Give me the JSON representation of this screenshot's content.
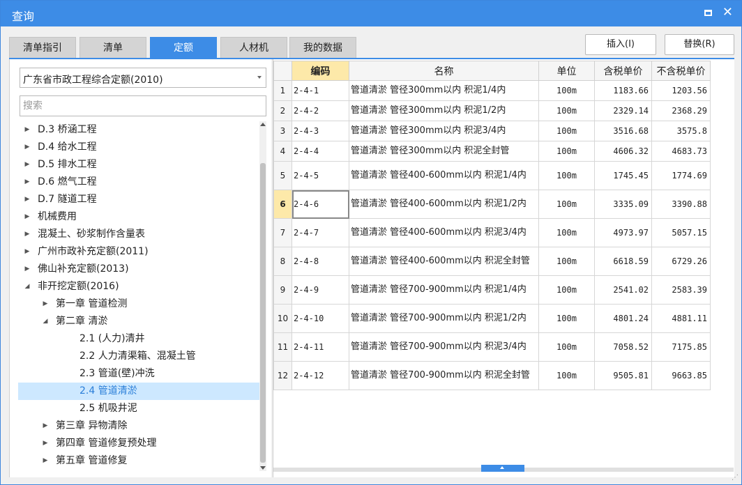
{
  "window": {
    "title": "查询",
    "max_icon": "maximize-icon",
    "close_glyph": "✕"
  },
  "tabs": [
    {
      "label": "清单指引",
      "active": false
    },
    {
      "label": "清单",
      "active": false
    },
    {
      "label": "定额",
      "active": true
    },
    {
      "label": "人材机",
      "active": false
    },
    {
      "label": "我的数据",
      "active": false
    }
  ],
  "toolbar": {
    "insert_label": "插入(I)",
    "replace_label": "替换(R)"
  },
  "left": {
    "selected_library": "广东省市政工程综合定额(2010)",
    "search_placeholder": "搜索",
    "tree": [
      {
        "label": "D.3 桥涵工程",
        "level": 0,
        "toggle": "collapsed"
      },
      {
        "label": "D.4 给水工程",
        "level": 0,
        "toggle": "collapsed"
      },
      {
        "label": "D.5 排水工程",
        "level": 0,
        "toggle": "collapsed"
      },
      {
        "label": "D.6 燃气工程",
        "level": 0,
        "toggle": "collapsed"
      },
      {
        "label": "D.7 隧道工程",
        "level": 0,
        "toggle": "collapsed"
      },
      {
        "label": "机械费用",
        "level": 0,
        "toggle": "collapsed"
      },
      {
        "label": "混凝土、砂浆制作含量表",
        "level": 0,
        "toggle": "collapsed"
      },
      {
        "label": "广州市政补充定额(2011)",
        "level": 0,
        "toggle": "collapsed"
      },
      {
        "label": "佛山补充定额(2013)",
        "level": 0,
        "toggle": "collapsed"
      },
      {
        "label": "非开挖定额(2016)",
        "level": 0,
        "toggle": "expanded"
      },
      {
        "label": "第一章 管道检测",
        "level": 1,
        "toggle": "collapsed"
      },
      {
        "label": "第二章 清淤",
        "level": 1,
        "toggle": "expanded"
      },
      {
        "label": "2.1 (人力)清井",
        "level": 2,
        "toggle": "none"
      },
      {
        "label": "2.2 人力清渠箱、混凝土管",
        "level": 2,
        "toggle": "none"
      },
      {
        "label": "2.3 管道(壁)冲洗",
        "level": 2,
        "toggle": "none"
      },
      {
        "label": "2.4 管道清淤",
        "level": 2,
        "toggle": "none",
        "selected": true
      },
      {
        "label": "2.5 机吸井泥",
        "level": 2,
        "toggle": "none"
      },
      {
        "label": "第三章 异物清除",
        "level": 1,
        "toggle": "collapsed"
      },
      {
        "label": "第四章 管道修复预处理",
        "level": 1,
        "toggle": "collapsed"
      },
      {
        "label": "第五章 管道修复",
        "level": 1,
        "toggle": "collapsed"
      }
    ]
  },
  "grid": {
    "columns": [
      "编码",
      "名称",
      "单位",
      "含税单价",
      "不含税单价"
    ],
    "current_row": 6,
    "rows": [
      {
        "idx": "1",
        "code": "2-4-1",
        "name": "管道清淤 管径300mm以内 积泥1/4内",
        "unit": "100m",
        "tax": "1183.66",
        "notax": "1203.56"
      },
      {
        "idx": "2",
        "code": "2-4-2",
        "name": "管道清淤 管径300mm以内 积泥1/2内",
        "unit": "100m",
        "tax": "2329.14",
        "notax": "2368.29"
      },
      {
        "idx": "3",
        "code": "2-4-3",
        "name": "管道清淤 管径300mm以内 积泥3/4内",
        "unit": "100m",
        "tax": "3516.68",
        "notax": "3575.8"
      },
      {
        "idx": "4",
        "code": "2-4-4",
        "name": "管道清淤 管径300mm以内 积泥全封管",
        "unit": "100m",
        "tax": "4606.32",
        "notax": "4683.73"
      },
      {
        "idx": "5",
        "code": "2-4-5",
        "name": "管道清淤 管径400-600mm以内 积泥1/4内",
        "unit": "100m",
        "tax": "1745.45",
        "notax": "1774.69"
      },
      {
        "idx": "6",
        "code": "2-4-6",
        "name": "管道清淤 管径400-600mm以内 积泥1/2内",
        "unit": "100m",
        "tax": "3335.09",
        "notax": "3390.88"
      },
      {
        "idx": "7",
        "code": "2-4-7",
        "name": "管道清淤 管径400-600mm以内 积泥3/4内",
        "unit": "100m",
        "tax": "4973.97",
        "notax": "5057.15"
      },
      {
        "idx": "8",
        "code": "2-4-8",
        "name": "管道清淤 管径400-600mm以内 积泥全封管",
        "unit": "100m",
        "tax": "6618.59",
        "notax": "6729.26"
      },
      {
        "idx": "9",
        "code": "2-4-9",
        "name": "管道清淤 管径700-900mm以内 积泥1/4内",
        "unit": "100m",
        "tax": "2541.02",
        "notax": "2583.39"
      },
      {
        "idx": "10",
        "code": "2-4-10",
        "name": "管道清淤 管径700-900mm以内 积泥1/2内",
        "unit": "100m",
        "tax": "4801.24",
        "notax": "4881.11"
      },
      {
        "idx": "11",
        "code": "2-4-11",
        "name": "管道清淤 管径700-900mm以内 积泥3/4内",
        "unit": "100m",
        "tax": "7058.52",
        "notax": "7175.85"
      },
      {
        "idx": "12",
        "code": "2-4-12",
        "name": "管道清淤 管径700-900mm以内 积泥全封管",
        "unit": "100m",
        "tax": "9505.81",
        "notax": "9663.85"
      }
    ]
  },
  "colors": {
    "accent": "#3d8ce6",
    "highlight": "#fde9a9",
    "selected_bg": "#cde8ff"
  }
}
